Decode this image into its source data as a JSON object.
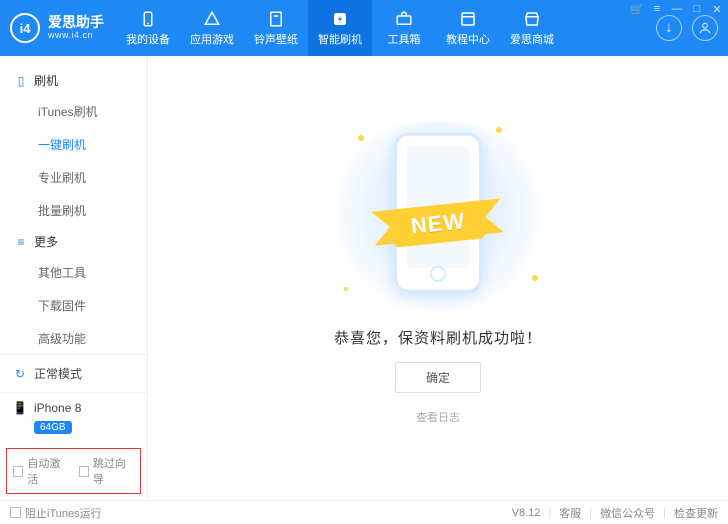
{
  "app": {
    "name_cn": "爱思助手",
    "name_en": "www.i4.cn",
    "logo_text": "i4",
    "version": "V8.12"
  },
  "winctrl": {
    "cart": "🛒",
    "menu": "≡",
    "min": "—",
    "max": "□",
    "close": "✕"
  },
  "headright": {
    "download_icon": "↓",
    "user_icon": "👤"
  },
  "tabs": [
    {
      "label": "我的设备",
      "icon": "phone"
    },
    {
      "label": "应用游戏",
      "icon": "apps"
    },
    {
      "label": "铃声壁纸",
      "icon": "note"
    },
    {
      "label": "智能刷机",
      "icon": "flash",
      "active": true
    },
    {
      "label": "工具箱",
      "icon": "kit"
    },
    {
      "label": "教程中心",
      "icon": "book"
    },
    {
      "label": "爱思商城",
      "icon": "shop"
    }
  ],
  "sidebar": {
    "group1": {
      "title": "刷机",
      "items": [
        "iTunes刷机",
        "一键刷机",
        "专业刷机",
        "批量刷机"
      ],
      "activeIndex": 1
    },
    "group2": {
      "title": "更多",
      "items": [
        "其他工具",
        "下载固件",
        "高级功能"
      ]
    }
  },
  "mode": {
    "label": "正常模式",
    "icon": "↻"
  },
  "device": {
    "name": "iPhone 8",
    "storage": "64GB",
    "icon": "📱"
  },
  "checks": {
    "auto_activate": "自动激活",
    "skip_wizard": "跳过向导"
  },
  "main": {
    "ribbon": "NEW",
    "message": "恭喜您，保资料刷机成功啦！",
    "ok": "确定",
    "log": "查看日志"
  },
  "footer": {
    "block_itunes": "阻止iTunes运行",
    "links": [
      "客服",
      "微信公众号",
      "检查更新"
    ]
  }
}
